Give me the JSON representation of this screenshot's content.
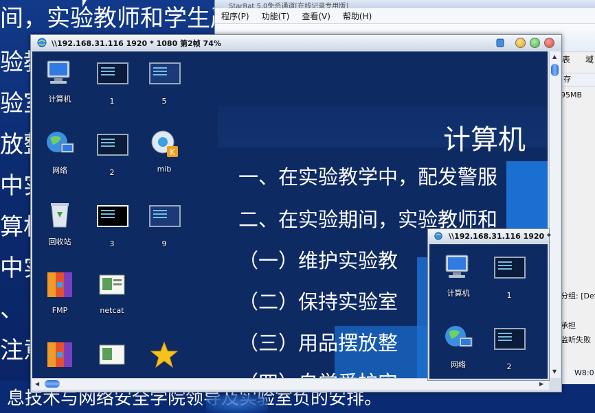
{
  "background": {
    "lines": [
      "间，实验教师和学生严",
      "验教",
      "验室",
      "放整",
      "中实",
      "算机",
      "中实",
      "、",
      "注意"
    ],
    "bottom_line": "息技术与网络安全学院领导及实验室负的安排。"
  },
  "back_window": {
    "title": "StarRat 5.0免杀通道[在线记录专用版]",
    "menu": [
      "程序(P)",
      "功能(T)",
      "查看(V)",
      "帮助(H)"
    ],
    "toolbar_labels": [
      "表",
      "域"
    ],
    "column_header": "存",
    "cell_value": "95MB",
    "right_cells": [
      "分组: [Def",
      "承担",
      "监听失败"
    ],
    "status": "W8:0"
  },
  "remote_window": {
    "title": "\\\\192.168.31.116 1920 * 1080 第2帧 74%",
    "slide": {
      "title": "计算机",
      "lines": [
        "一、在实验教学中，配发警服",
        "二、在实验期间，实验教师和",
        "（一）维护实验教",
        "（二）保持实验室",
        "（三）用品摆放整",
        "（四）自觉爱护实"
      ]
    },
    "icons": [
      {
        "label": "计算机",
        "icon": "computer-icon"
      },
      {
        "label": "1",
        "icon": "terminal-thumb-icon"
      },
      {
        "label": "5",
        "icon": "desktop-thumb-icon"
      },
      {
        "label": "网络",
        "icon": "network-globe-icon"
      },
      {
        "label": "2",
        "icon": "terminal-thumb-icon"
      },
      {
        "label": "mib",
        "icon": "mib-app-icon"
      },
      {
        "label": "回收站",
        "icon": "recycle-bin-icon"
      },
      {
        "label": "3",
        "icon": "terminal-thumb-icon"
      },
      {
        "label": "9",
        "icon": "desktop-thumb-icon"
      },
      {
        "label": "FMP",
        "icon": "fmp-app-icon"
      },
      {
        "label": "netcat",
        "icon": "netcat-icon"
      },
      {
        "label": "",
        "icon": "fmp-app-icon"
      },
      {
        "label": "",
        "icon": "netcat-icon"
      },
      {
        "label": "",
        "icon": "star-icon"
      }
    ]
  },
  "remote_window_2": {
    "title": "\\\\192.168.31.116 1920 *",
    "icons": [
      {
        "label": "计算机",
        "icon": "computer-icon"
      },
      {
        "label": "1",
        "icon": "terminal-thumb-icon"
      },
      {
        "label": "网络",
        "icon": "network-globe-icon"
      },
      {
        "label": "2",
        "icon": "terminal-thumb-icon"
      }
    ]
  },
  "colors": {
    "desktop_bg": "#0b2a6e",
    "remote_bg": "#0e2a63",
    "slide_blue": "#1a6fd0",
    "close_btn": "#d9473c",
    "max_btn": "#4bb34a",
    "min_btn": "#e3a21a"
  }
}
